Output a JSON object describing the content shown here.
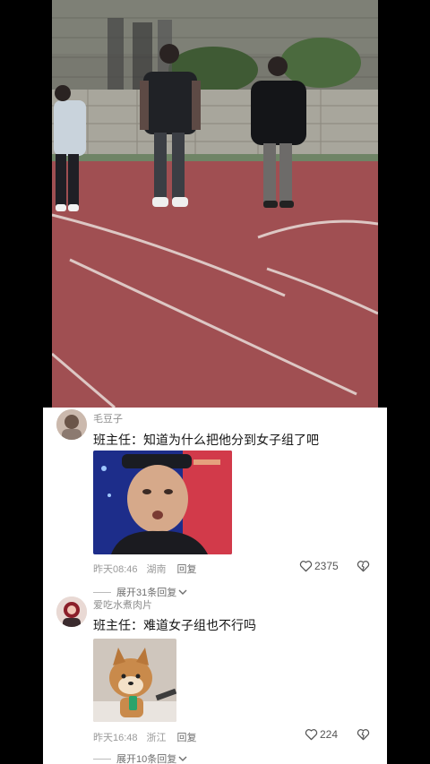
{
  "comments": [
    {
      "username": "毛豆子",
      "text": "班主任：知道为什么把他分到女子组了吧",
      "time": "昨天08:46",
      "location": "湖南",
      "reply_label": "回复",
      "likes": "2375",
      "expand_replies": "展开31条回复"
    },
    {
      "username": "爱吃水煮肉片",
      "text": "班主任：难道女子组也不行吗",
      "time": "昨天16:48",
      "location": "浙江",
      "reply_label": "回复",
      "likes": "224",
      "expand_replies": "展开10条回复"
    }
  ],
  "icons": {
    "like": "heart-outline-icon",
    "dislike": "broken-heart-icon",
    "expand": "chevron-down-icon"
  },
  "colors": {
    "track": "#a04f52",
    "panel_bg": "#ffffff",
    "meta_text": "#9a9a9a"
  }
}
